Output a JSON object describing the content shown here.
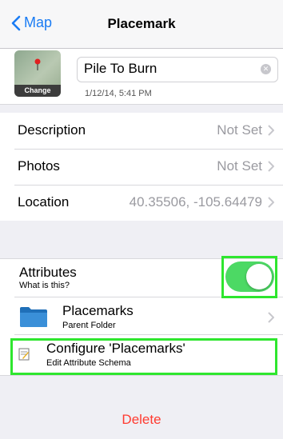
{
  "navbar": {
    "back_label": "Map",
    "title": "Placemark"
  },
  "header": {
    "thumb_label": "Change",
    "name_value": "Pile To Burn",
    "date": "1/12/14, 5:41 PM"
  },
  "details": [
    {
      "label": "Description",
      "value": "Not Set"
    },
    {
      "label": "Photos",
      "value": "Not Set"
    },
    {
      "label": "Location",
      "value": "40.35506, -105.64479"
    }
  ],
  "attributes": {
    "label": "Attributes",
    "sub": "What is this?",
    "toggle_on": true,
    "toggle_color": "#4cd964"
  },
  "folder": {
    "title": "Placemarks",
    "sub": "Parent Folder"
  },
  "configure": {
    "title": "Configure 'Placemarks'",
    "sub": "Edit Attribute Schema"
  },
  "delete_label": "Delete",
  "colors": {
    "accent": "#1a7cf4",
    "highlight": "#2ee62e",
    "delete": "#ff3b30"
  }
}
